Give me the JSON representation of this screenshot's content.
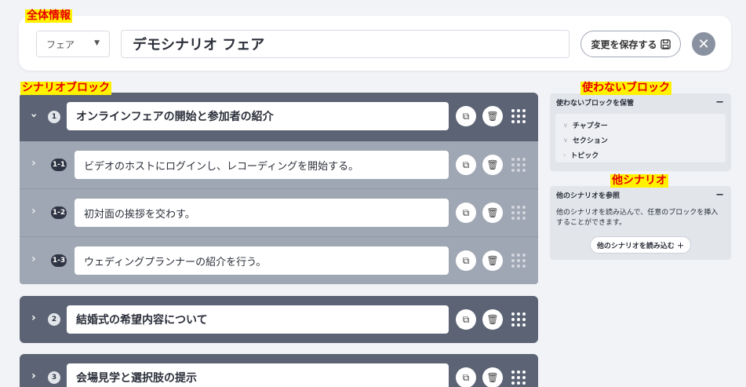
{
  "annotations": {
    "overall_info": "全体情報",
    "scenario_block": "シナリオブロック",
    "unused_block": "使わないブロック",
    "other_scenario": "他シナリオ"
  },
  "header": {
    "scope_select": "フェア",
    "title": "デモシナリオ フェア",
    "save_label": "変更を保存する"
  },
  "blocks": [
    {
      "number": "1",
      "title": "オンラインフェアの開始と参加者の紹介",
      "children": [
        {
          "number": "1-1",
          "title": "ビデオのホストにログインし、レコーディングを開始する。"
        },
        {
          "number": "1-2",
          "title": "初対面の挨拶を交わす。"
        },
        {
          "number": "1-3",
          "title": "ウェディングプランナーの紹介を行う。"
        }
      ]
    },
    {
      "number": "2",
      "title": "結婚式の希望内容について"
    },
    {
      "number": "3",
      "title": "会場見学と選択肢の提示"
    }
  ],
  "unused_panel": {
    "title": "使わないブロックを保管",
    "items": [
      "チャプター",
      "セクション",
      "トピック"
    ]
  },
  "other_panel": {
    "title": "他のシナリオを参照",
    "description": "他のシナリオを読み込んで、任意のブロックを挿入することができます。",
    "button_label": "他のシナリオを読み込む ＋"
  }
}
